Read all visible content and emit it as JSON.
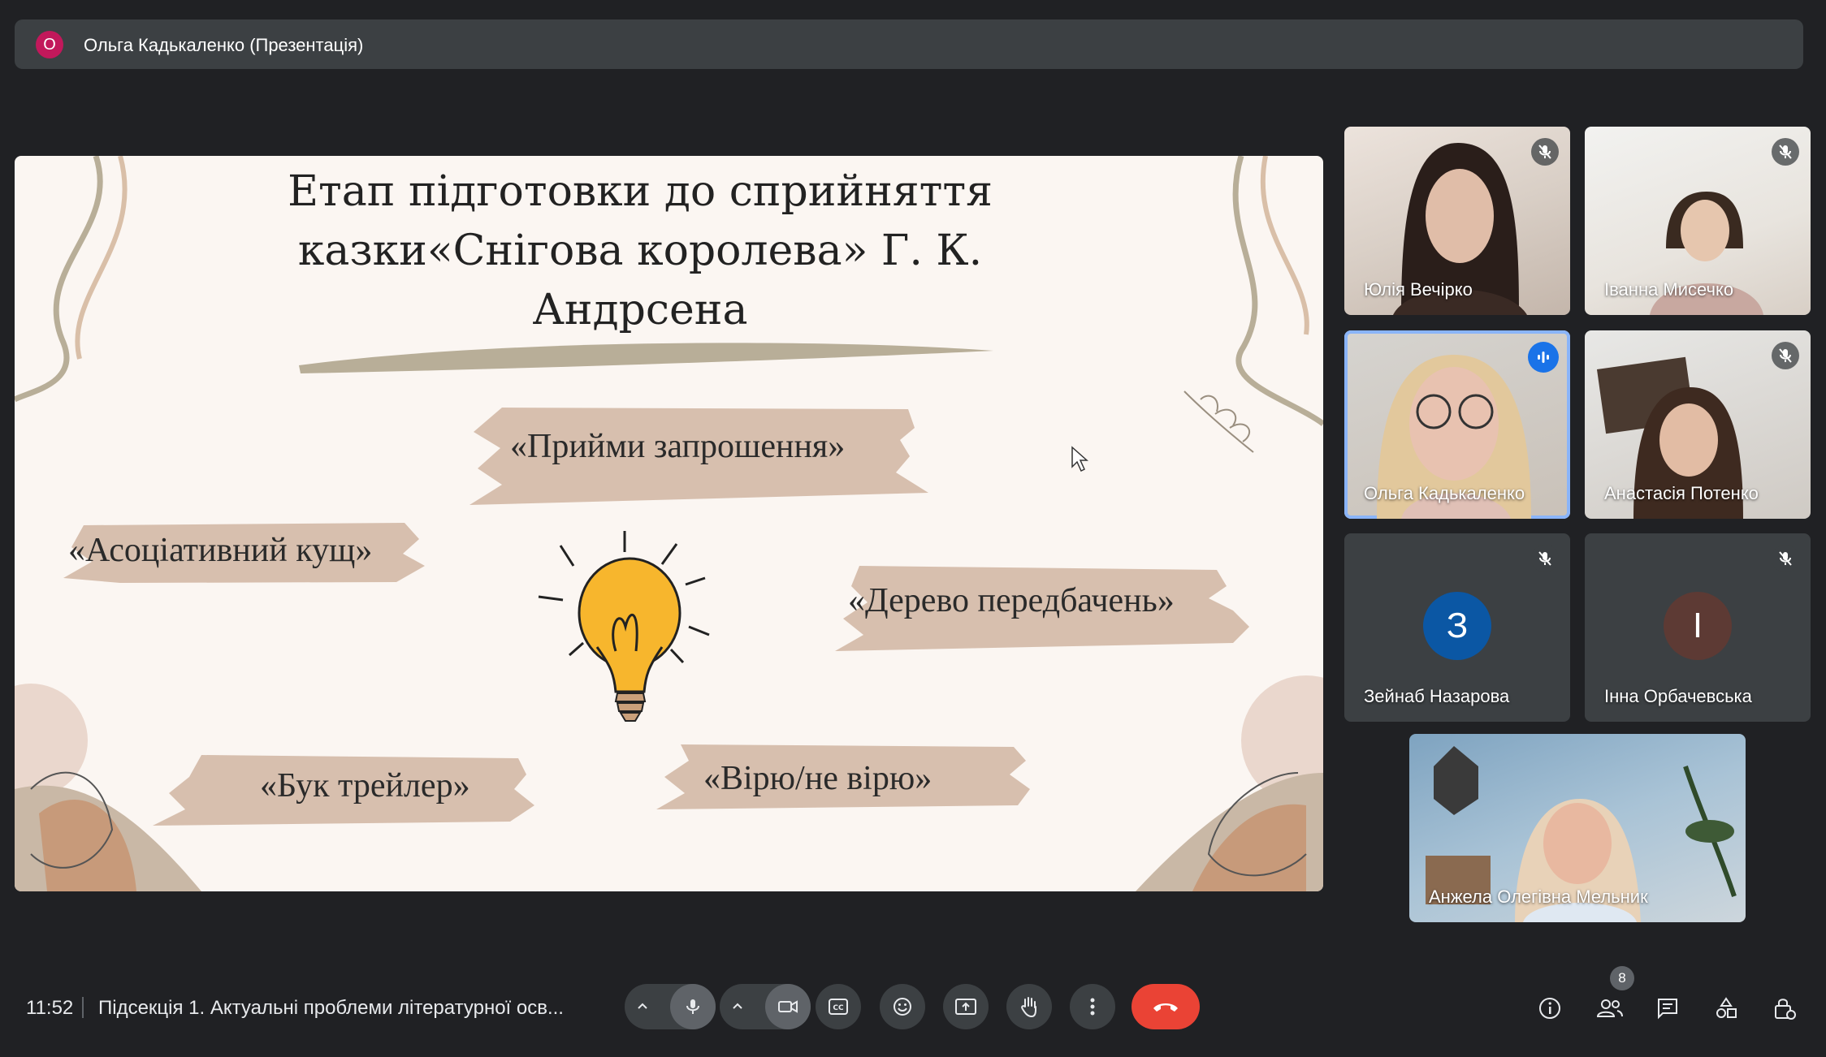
{
  "presenter": {
    "initial": "О",
    "label": "Ольга Кадькаленко (Презентація)"
  },
  "slide": {
    "title_lines": [
      "Етап підготовки до сприйняття",
      "казки«Снігова королева» Г. К.",
      "Андрсена"
    ],
    "phrases": {
      "invite": "«Прийми запрошення»",
      "assoc": "«Асоціативний кущ»",
      "tree": "«Дерево передбачень»",
      "book": "«Бук трейлер»",
      "believe": "«Вірю/не вірю»"
    }
  },
  "participants": [
    {
      "name": "Юлія Вечірко",
      "muted": true
    },
    {
      "name": "Іванна Мисечко",
      "muted": true
    },
    {
      "name": "Ольга Кадькаленко",
      "speaking": true
    },
    {
      "name": "Анастасія Потенко",
      "muted": true
    },
    {
      "name": "Зейнаб Назарова",
      "initial": "З",
      "avatar_color": "#0b57a4",
      "muted": true
    },
    {
      "name": "Інна Орбачевська",
      "initial": "І",
      "avatar_color": "#5d3a34",
      "muted": true
    },
    {
      "name": "Анжела Олегівна Мельник"
    }
  ],
  "bottom": {
    "time": "11:52",
    "meeting_title": "Підсекція 1. Актуальні проблеми літературної осв...",
    "people_count": "8",
    "leave_color": "#ea4335"
  },
  "icons": [
    "mic-icon",
    "camera-icon",
    "captions-icon",
    "emoji-icon",
    "present-icon",
    "raise-hand-icon",
    "more-icon",
    "leave-call-icon",
    "info-icon",
    "people-icon",
    "chat-icon",
    "activities-icon",
    "host-controls-icon"
  ]
}
